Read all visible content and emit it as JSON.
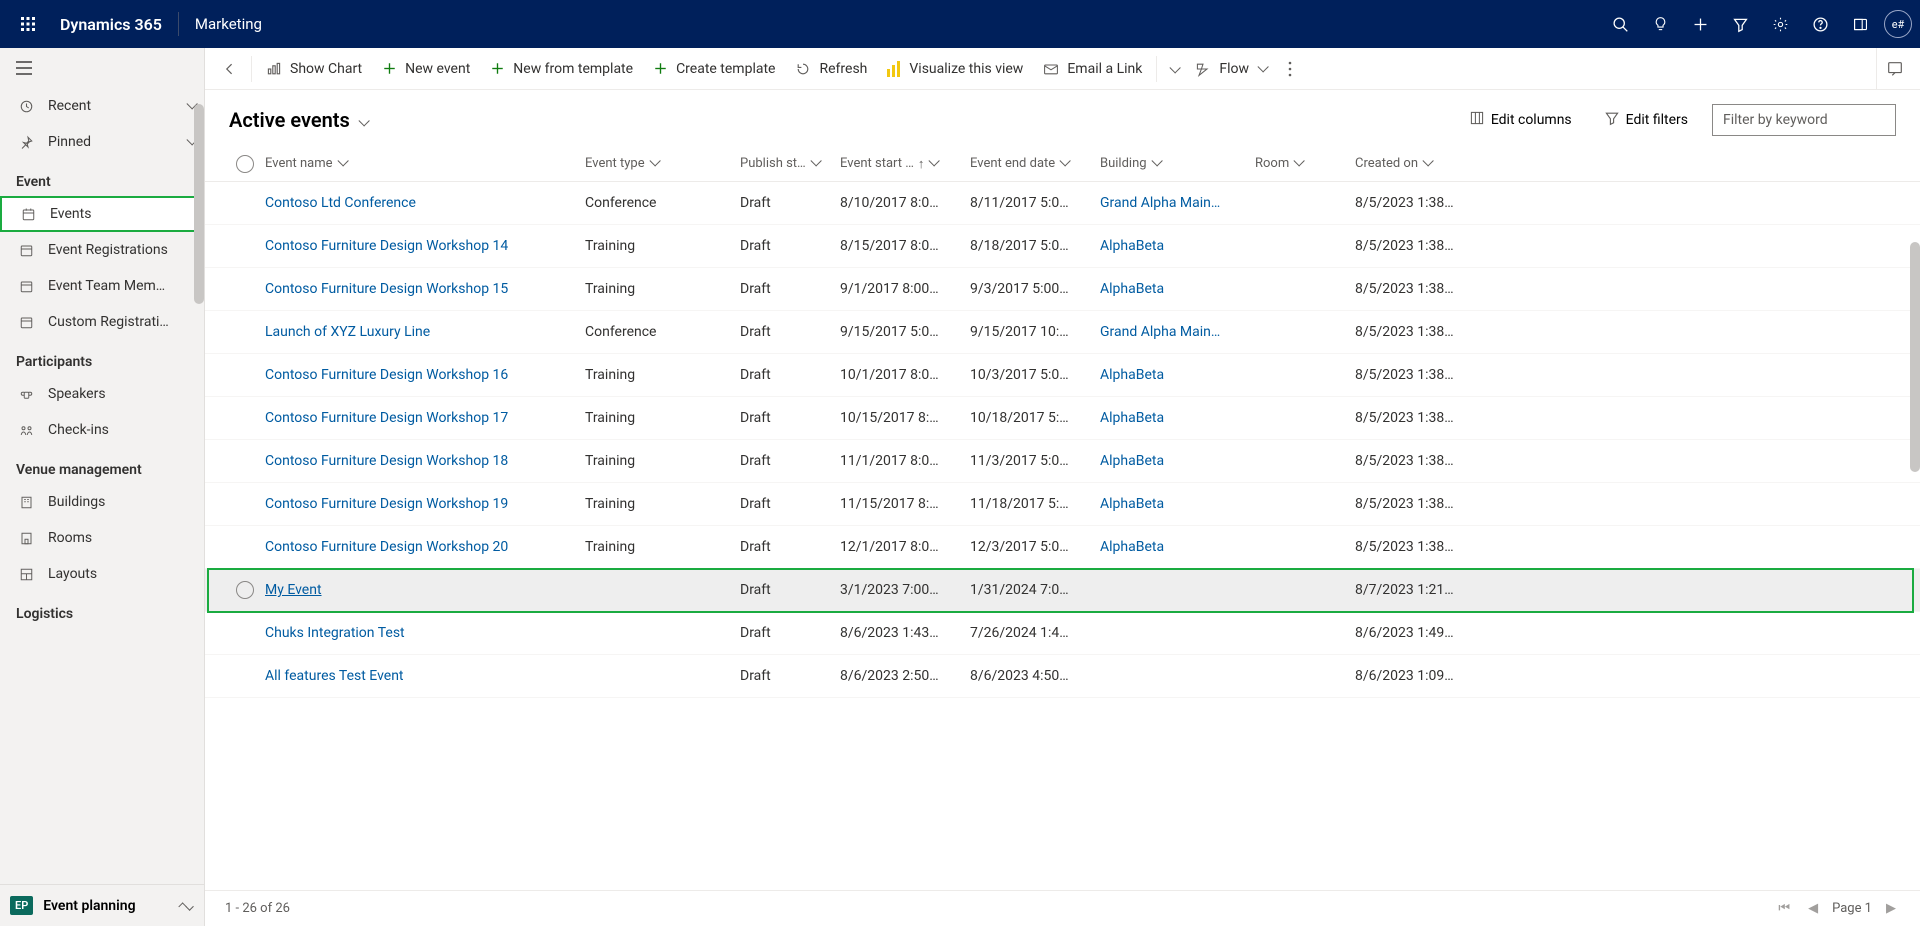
{
  "topbar": {
    "brand": "Dynamics 365",
    "area": "Marketing",
    "avatar": "e#"
  },
  "nav": {
    "recent": "Recent",
    "pinned": "Pinned",
    "sections": [
      {
        "title": "Event",
        "items": [
          "Events",
          "Event Registrations",
          "Event Team Mem…",
          "Custom Registrati…"
        ]
      },
      {
        "title": "Participants",
        "items": [
          "Speakers",
          "Check-ins"
        ]
      },
      {
        "title": "Venue management",
        "items": [
          "Buildings",
          "Rooms",
          "Layouts"
        ]
      },
      {
        "title": "Logistics",
        "items": []
      }
    ],
    "highlight_item": "Events",
    "area_switch": {
      "badge": "EP",
      "label": "Event planning"
    }
  },
  "commands": {
    "show_chart": "Show Chart",
    "new_event": "New event",
    "new_template": "New from template",
    "create_template": "Create template",
    "refresh": "Refresh",
    "visualize": "Visualize this view",
    "email_link": "Email a Link",
    "flow": "Flow"
  },
  "view": {
    "title": "Active events",
    "edit_columns": "Edit columns",
    "edit_filters": "Edit filters",
    "filter_placeholder": "Filter by keyword"
  },
  "columns": {
    "name": "Event name",
    "type": "Event type",
    "pub": "Publish st…",
    "start": "Event start …",
    "end": "Event end date",
    "bld": "Building",
    "room": "Room",
    "crt": "Created on"
  },
  "rows": [
    {
      "name": "Contoso Ltd Conference",
      "type": "Conference",
      "pub": "Draft",
      "start": "8/10/2017 8:0…",
      "end": "8/11/2017 5:0…",
      "bld": "Grand Alpha Main…",
      "room": "",
      "crt": "8/5/2023 1:38…"
    },
    {
      "name": "Contoso Furniture Design Workshop 14",
      "type": "Training",
      "pub": "Draft",
      "start": "8/15/2017 8:0…",
      "end": "8/18/2017 5:0…",
      "bld": "AlphaBeta",
      "room": "",
      "crt": "8/5/2023 1:38…"
    },
    {
      "name": "Contoso Furniture Design Workshop 15",
      "type": "Training",
      "pub": "Draft",
      "start": "9/1/2017 8:00…",
      "end": "9/3/2017 5:00…",
      "bld": "AlphaBeta",
      "room": "",
      "crt": "8/5/2023 1:38…"
    },
    {
      "name": "Launch of XYZ Luxury Line",
      "type": "Conference",
      "pub": "Draft",
      "start": "9/15/2017 5:0…",
      "end": "9/15/2017 10:…",
      "bld": "Grand Alpha Main…",
      "room": "",
      "crt": "8/5/2023 1:38…"
    },
    {
      "name": "Contoso Furniture Design Workshop 16",
      "type": "Training",
      "pub": "Draft",
      "start": "10/1/2017 8:0…",
      "end": "10/3/2017 5:0…",
      "bld": "AlphaBeta",
      "room": "",
      "crt": "8/5/2023 1:38…"
    },
    {
      "name": "Contoso Furniture Design Workshop 17",
      "type": "Training",
      "pub": "Draft",
      "start": "10/15/2017 8:…",
      "end": "10/18/2017 5:…",
      "bld": "AlphaBeta",
      "room": "",
      "crt": "8/5/2023 1:38…"
    },
    {
      "name": "Contoso Furniture Design Workshop 18",
      "type": "Training",
      "pub": "Draft",
      "start": "11/1/2017 8:0…",
      "end": "11/3/2017 5:0…",
      "bld": "AlphaBeta",
      "room": "",
      "crt": "8/5/2023 1:38…"
    },
    {
      "name": "Contoso Furniture Design Workshop 19",
      "type": "Training",
      "pub": "Draft",
      "start": "11/15/2017 8:…",
      "end": "11/18/2017 5:…",
      "bld": "AlphaBeta",
      "room": "",
      "crt": "8/5/2023 1:38…"
    },
    {
      "name": "Contoso Furniture Design Workshop 20",
      "type": "Training",
      "pub": "Draft",
      "start": "12/1/2017 8:0…",
      "end": "12/3/2017 5:0…",
      "bld": "AlphaBeta",
      "room": "",
      "crt": "8/5/2023 1:38…"
    },
    {
      "name": "My Event",
      "type": "",
      "pub": "Draft",
      "start": "3/1/2023 7:00…",
      "end": "1/31/2024 7:0…",
      "bld": "",
      "room": "",
      "crt": "8/7/2023 1:21…",
      "selected": true,
      "highlight": true
    },
    {
      "name": "Chuks Integration Test",
      "type": "",
      "pub": "Draft",
      "start": "8/6/2023 1:43…",
      "end": "7/26/2024 1:4…",
      "bld": "",
      "room": "",
      "crt": "8/6/2023 1:49…"
    },
    {
      "name": "All features Test Event",
      "type": "",
      "pub": "Draft",
      "start": "8/6/2023 2:50…",
      "end": "8/6/2023 4:50…",
      "bld": "",
      "room": "",
      "crt": "8/6/2023 1:09…"
    }
  ],
  "footer": {
    "count": "1 - 26 of 26",
    "page": "Page 1"
  }
}
